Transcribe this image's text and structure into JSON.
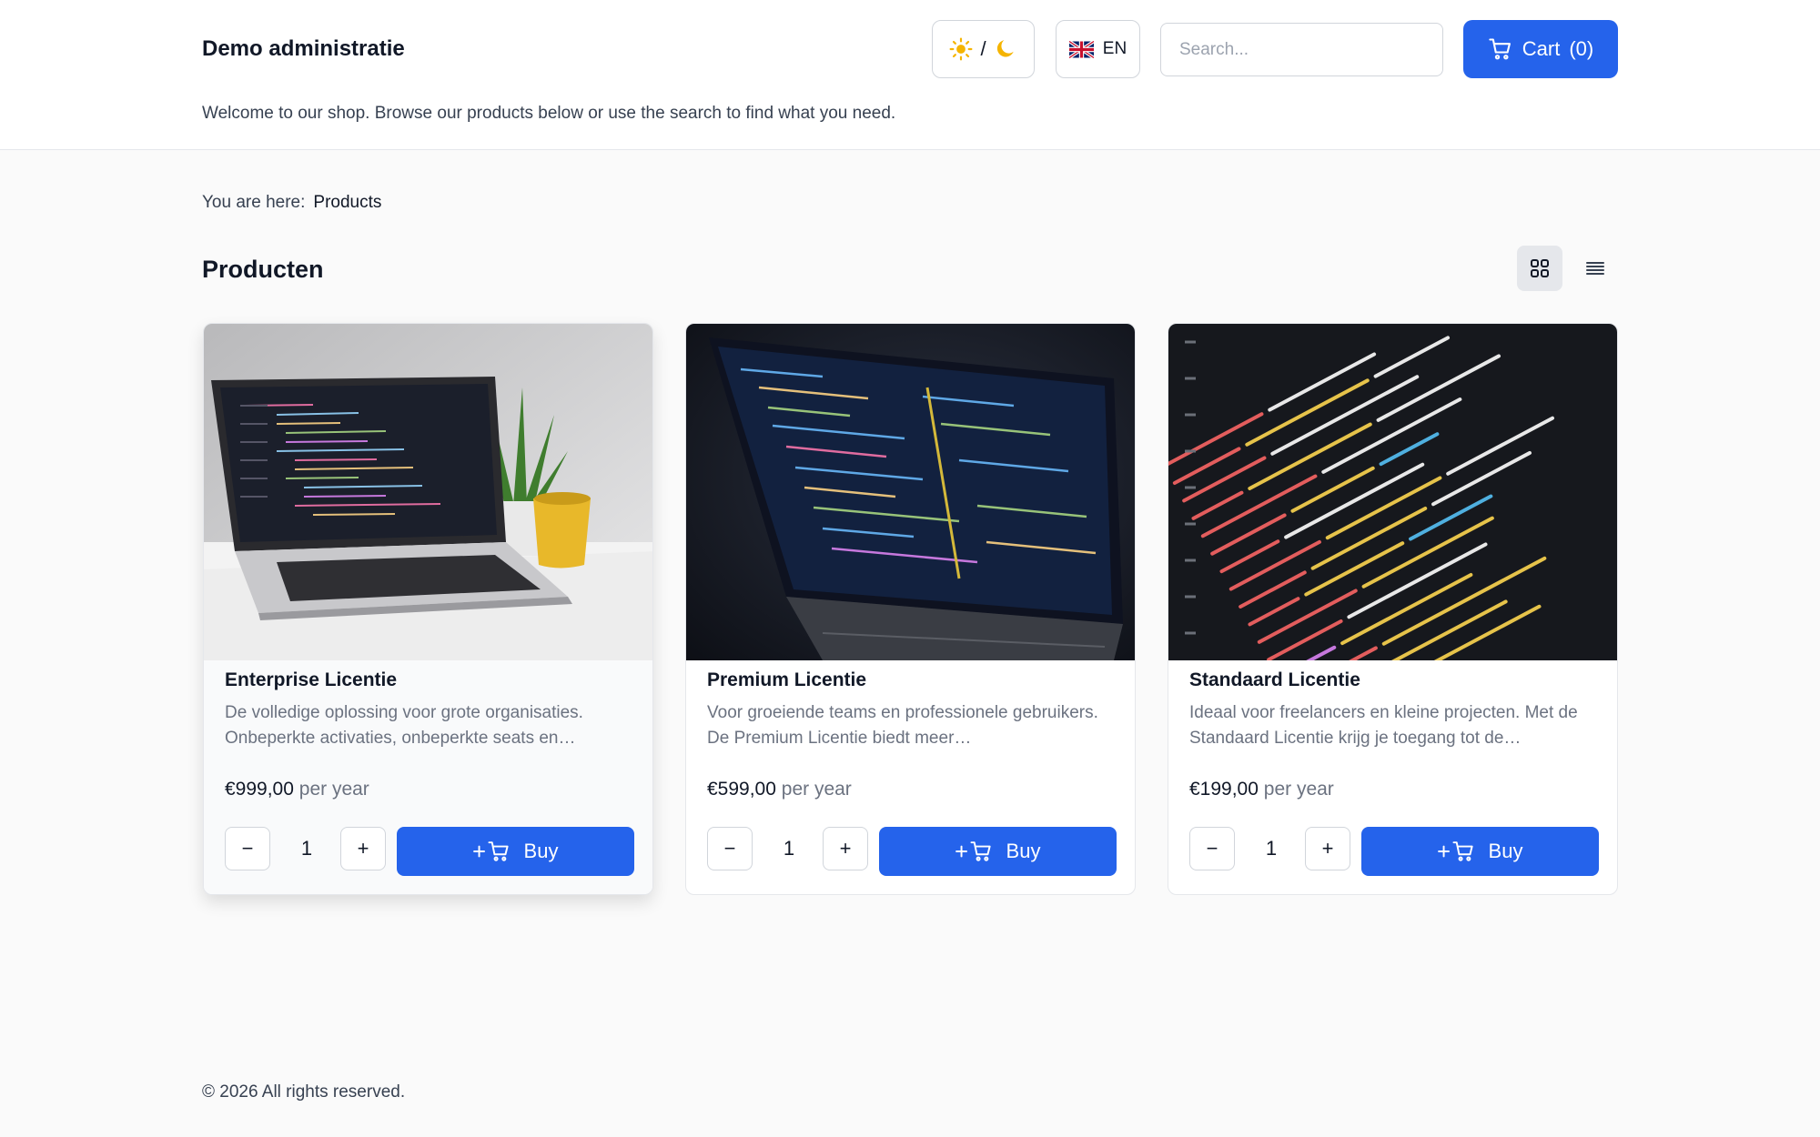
{
  "header": {
    "brand": "Demo administratie",
    "welcome": "Welcome to our shop. Browse our products below or use the search to find what you need.",
    "theme_separator": "/",
    "language": "EN",
    "search_placeholder": "Search...",
    "cart_label": "Cart",
    "cart_count": "(0)"
  },
  "breadcrumb": {
    "label": "You are here:",
    "current": "Products"
  },
  "page_title": "Producten",
  "products": [
    {
      "name": "Enterprise Licentie",
      "description": "De volledige oplossing voor grote organisaties. Onbeperkte activaties, onbeperkte seats en…",
      "price": "€999,00",
      "period": "per year",
      "quantity": "1",
      "buy_label": "Buy"
    },
    {
      "name": "Premium Licentie",
      "description": "Voor groeiende teams en professionele gebruikers. De Premium Licentie biedt meer…",
      "price": "€599,00",
      "period": "per year",
      "quantity": "1",
      "buy_label": "Buy"
    },
    {
      "name": "Standaard Licentie",
      "description": "Ideaal voor freelancers en kleine projecten. Met de Standaard Licentie krijg je toegang tot de…",
      "price": "€199,00",
      "period": "per year",
      "quantity": "1",
      "buy_label": "Buy"
    }
  ],
  "qty_minus": "−",
  "qty_plus": "+",
  "footer": "© 2026 All rights reserved.",
  "colors": {
    "accent": "#2563eb",
    "sun": "#f5b400",
    "moon": "#f5b400"
  },
  "icons": {
    "theme": [
      "sun-icon",
      "moon-icon"
    ],
    "language": "uk-flag-icon",
    "cart": "cart-icon",
    "grid_view": "grid-view-icon",
    "list_view": "list-view-icon"
  }
}
